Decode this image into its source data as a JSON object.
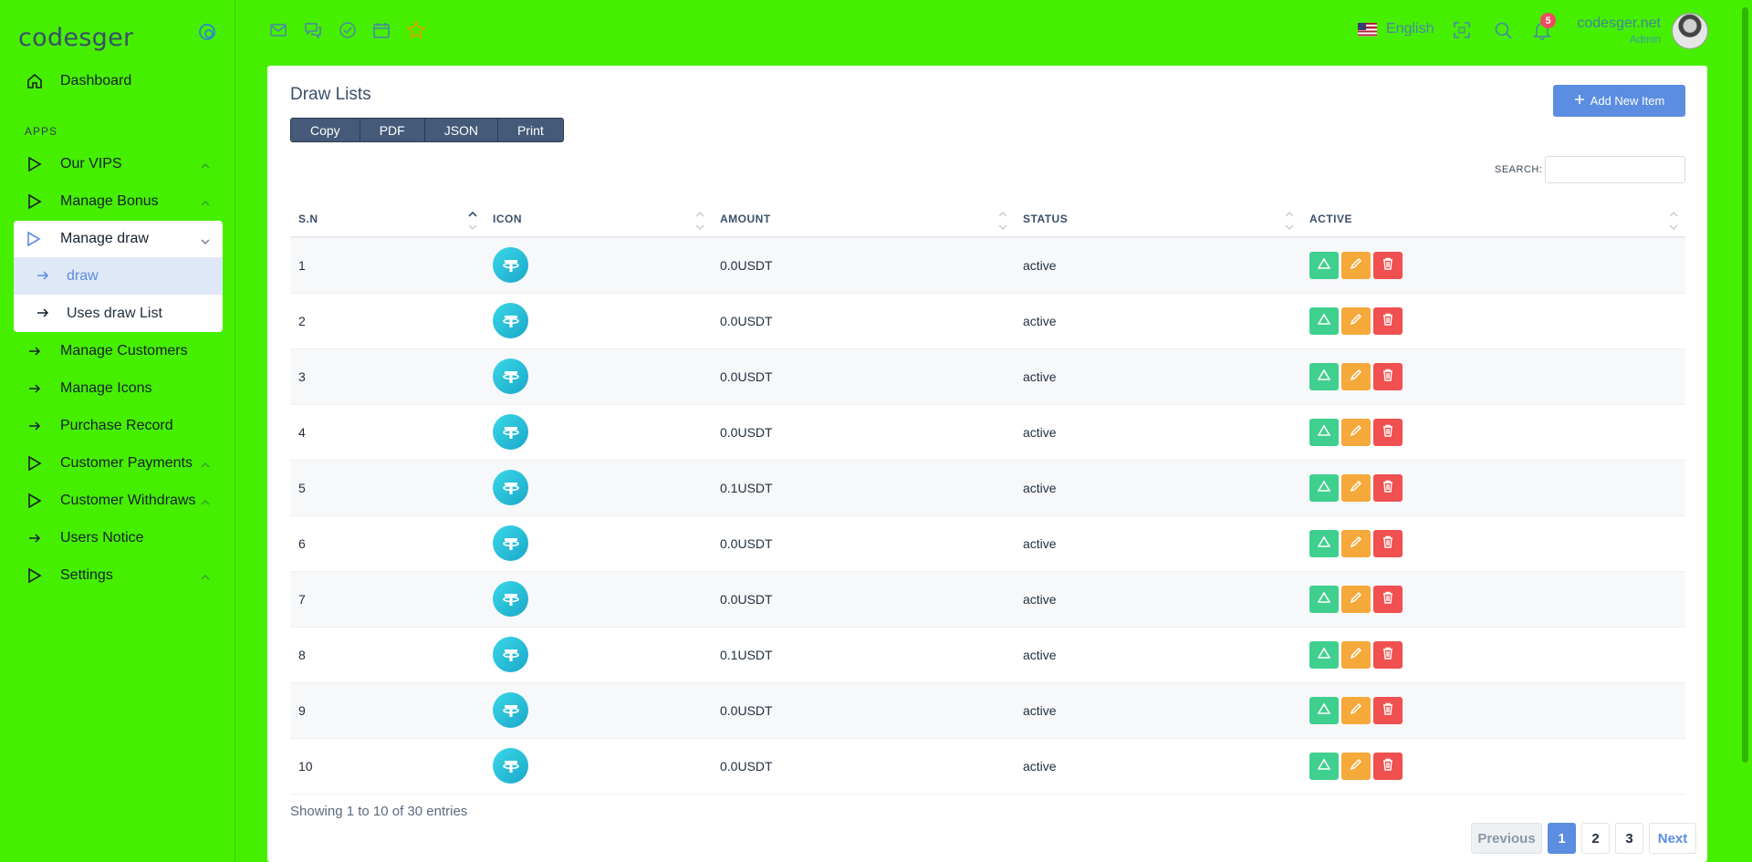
{
  "brand": "codesger",
  "sidebar": {
    "section_apps": "APPS",
    "items": [
      {
        "label": "Dashboard",
        "icon": "home-icon"
      },
      {
        "label": "Our VIPS",
        "icon": "play-icon"
      },
      {
        "label": "Manage Bonus",
        "icon": "play-icon"
      },
      {
        "label": "Manage draw",
        "icon": "play-icon"
      },
      {
        "label": "Manage Customers",
        "icon": "arrow-right-icon"
      },
      {
        "label": "Manage Icons",
        "icon": "arrow-right-icon"
      },
      {
        "label": "Purchase Record",
        "icon": "arrow-right-icon"
      },
      {
        "label": "Customer Payments",
        "icon": "play-icon"
      },
      {
        "label": "Customer Withdraws",
        "icon": "play-icon"
      },
      {
        "label": "Users Notice",
        "icon": "arrow-right-icon"
      },
      {
        "label": "Settings",
        "icon": "play-icon"
      }
    ],
    "submenu": [
      {
        "label": "draw"
      },
      {
        "label": "Uses draw List"
      }
    ]
  },
  "header": {
    "language": "English",
    "notifications_count": "5",
    "user_name": "codesger.net",
    "user_role": "Admin"
  },
  "card": {
    "title": "Draw Lists",
    "add_button": "Add New Item",
    "export": [
      "Copy",
      "PDF",
      "JSON",
      "Print"
    ],
    "search_label": "SEARCH:",
    "columns": [
      "S.N",
      "ICON",
      "AMOUNT",
      "STATUS",
      "ACTIVE"
    ],
    "rows": [
      {
        "sn": "1",
        "amount": "0.0USDT",
        "status": "active"
      },
      {
        "sn": "2",
        "amount": "0.0USDT",
        "status": "active"
      },
      {
        "sn": "3",
        "amount": "0.0USDT",
        "status": "active"
      },
      {
        "sn": "4",
        "amount": "0.0USDT",
        "status": "active"
      },
      {
        "sn": "5",
        "amount": "0.1USDT",
        "status": "active"
      },
      {
        "sn": "6",
        "amount": "0.0USDT",
        "status": "active"
      },
      {
        "sn": "7",
        "amount": "0.0USDT",
        "status": "active"
      },
      {
        "sn": "8",
        "amount": "0.1USDT",
        "status": "active"
      },
      {
        "sn": "9",
        "amount": "0.0USDT",
        "status": "active"
      },
      {
        "sn": "10",
        "amount": "0.0USDT",
        "status": "active"
      }
    ],
    "entries_info": "Showing 1 to 10 of 30 entries",
    "pagination": {
      "prev": "Previous",
      "pages": [
        "1",
        "2",
        "3"
      ],
      "next": "Next"
    }
  },
  "colors": {
    "background": "#46ef00",
    "accent": "#5b8de0",
    "view": "#3fcf8e",
    "edit": "#f5a93a",
    "delete": "#f0504f"
  }
}
